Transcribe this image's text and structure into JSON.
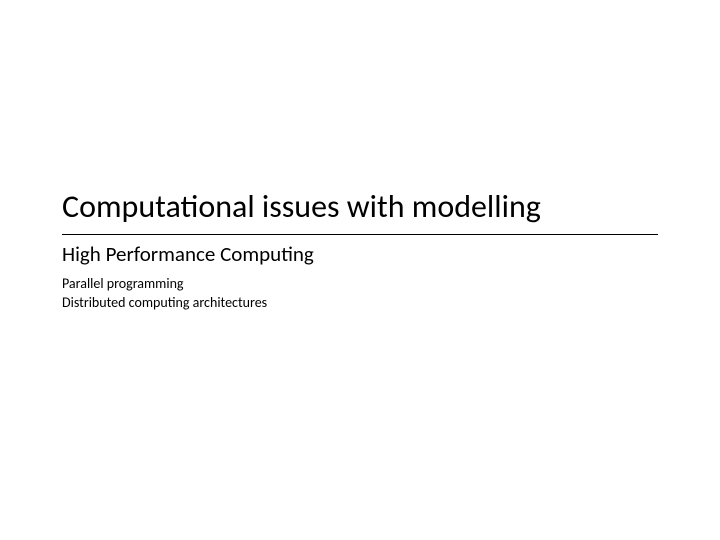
{
  "slide": {
    "title": "Computational issues with modelling",
    "subtitle": "High Performance Computing",
    "body_line_1": "Parallel programming",
    "body_line_2": "Distributed computing architectures"
  }
}
